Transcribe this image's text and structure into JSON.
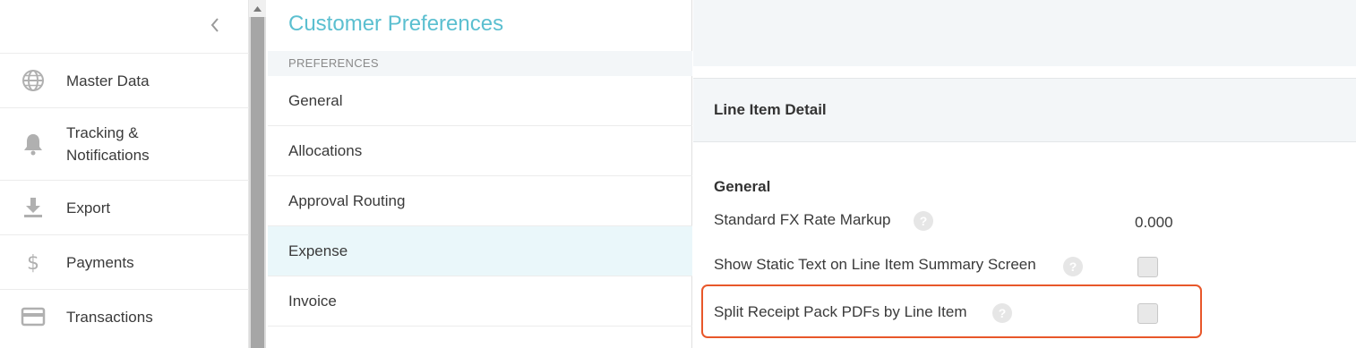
{
  "sidebar": {
    "items": [
      {
        "label": "Master Data",
        "icon": "globe-icon"
      },
      {
        "label": "Tracking & Notifications",
        "icon": "bell-icon"
      },
      {
        "label": "Export",
        "icon": "download-icon"
      },
      {
        "label": "Payments",
        "icon": "dollar-icon"
      },
      {
        "label": "Transactions",
        "icon": "credit-card-icon"
      }
    ]
  },
  "middle": {
    "title": "Customer Preferences",
    "section": "PREFERENCES",
    "items": [
      {
        "label": "General"
      },
      {
        "label": "Allocations"
      },
      {
        "label": "Approval Routing"
      },
      {
        "label": "Expense",
        "active": true
      },
      {
        "label": "Invoice"
      }
    ]
  },
  "detail": {
    "title": "Line Item Detail",
    "group": "General",
    "settings": [
      {
        "label": "Standard FX Rate Markup",
        "value": "0.000",
        "help": "?"
      },
      {
        "label": "Show Static Text on Line Item Summary Screen",
        "checked": false,
        "help": "?"
      },
      {
        "label": "Split Receipt Pack PDFs by Line Item",
        "checked": false,
        "help": "?"
      }
    ]
  },
  "colors": {
    "title_accent": "#5bbfd0",
    "active_bg": "#eaf7fa",
    "highlight_border": "#e8572a"
  }
}
